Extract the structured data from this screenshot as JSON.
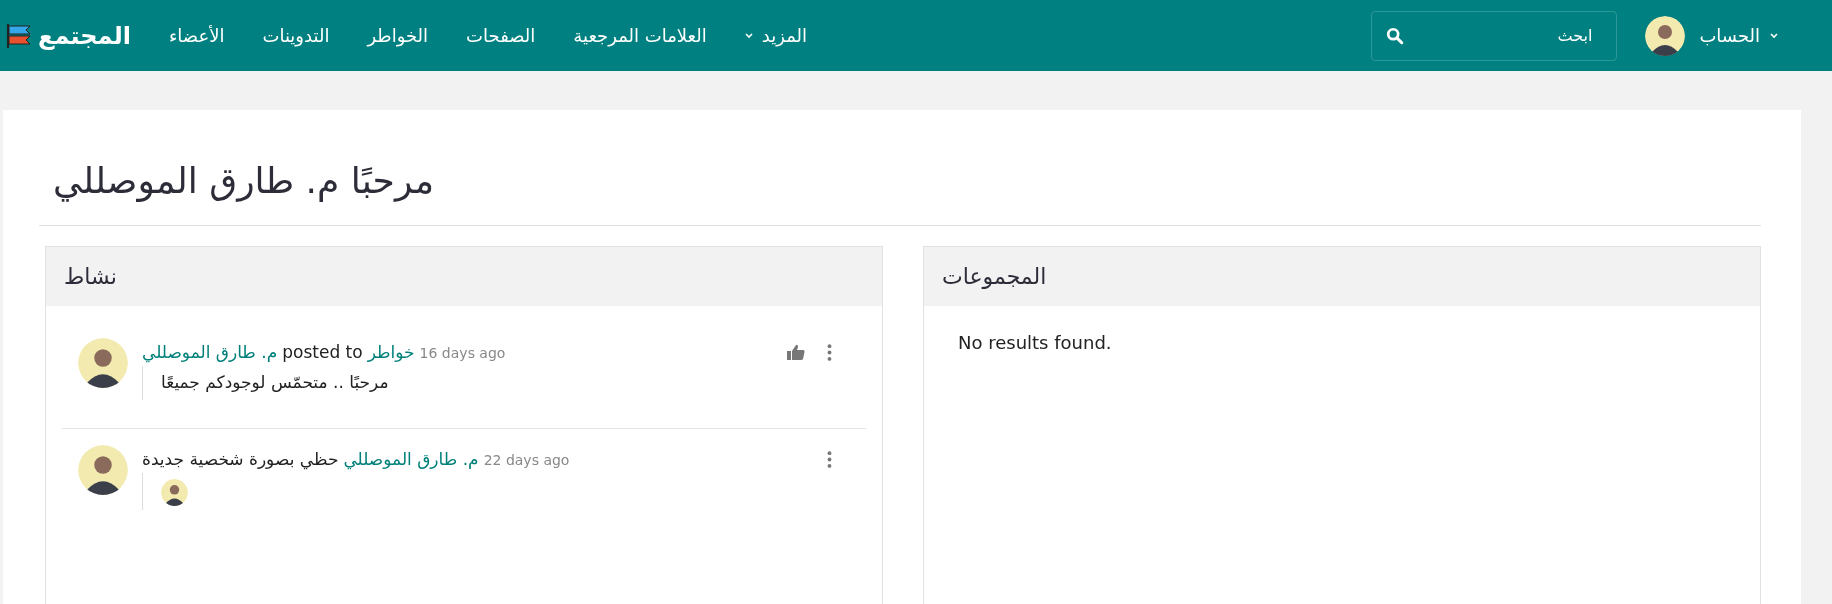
{
  "brand": {
    "name": "المجتمع"
  },
  "nav": [
    {
      "label": "المزيد",
      "dropdown": true
    },
    {
      "label": "العلامات المرجعية",
      "dropdown": false
    },
    {
      "label": "الصفحات",
      "dropdown": false
    },
    {
      "label": "الخواطر",
      "dropdown": false
    },
    {
      "label": "التدوينات",
      "dropdown": false
    },
    {
      "label": "الأعضاء",
      "dropdown": false
    }
  ],
  "search": {
    "placeholder": "ابحث"
  },
  "account": {
    "label": "الحساب"
  },
  "page_title": "مرحبًا م. طارق الموصللي",
  "activity": {
    "title": "نشاط",
    "items": [
      {
        "kind": "text",
        "likable": true,
        "header": [
          {
            "kind": "time",
            "text": "16 days ago"
          },
          {
            "kind": "link",
            "text": "خواطر"
          },
          {
            "kind": "text",
            "text": "posted to"
          },
          {
            "kind": "link",
            "text": "م. طارق الموصللي"
          }
        ],
        "body": "مرحبًا .. متحمّس لوجودكم جميعًا"
      },
      {
        "kind": "image",
        "likable": false,
        "header": [
          {
            "kind": "time",
            "text": "22 days ago"
          },
          {
            "kind": "link",
            "text": "م. طارق الموصللي"
          },
          {
            "kind": "text",
            "text": "حظي بصورة شخصية جديدة"
          }
        ]
      }
    ]
  },
  "groups": {
    "title": "المجموعات",
    "empty": "No results found."
  }
}
